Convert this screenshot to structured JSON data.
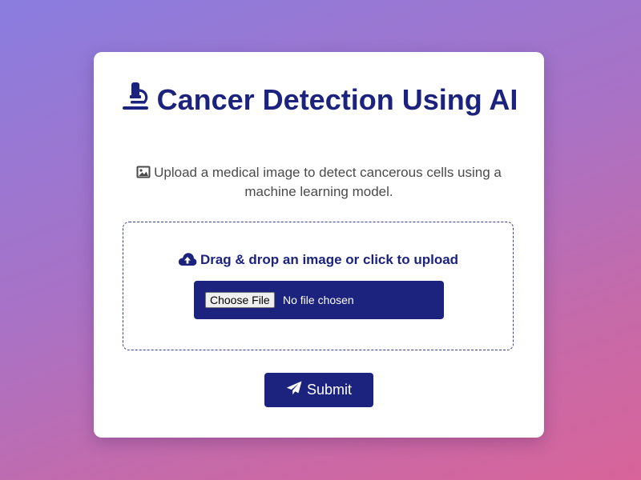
{
  "header": {
    "title": "Cancer Detection Using AI",
    "title_icon": "microscope-icon"
  },
  "description": {
    "text": "Upload a medical image to detect cancerous cells using a machine learning model.",
    "icon": "image-icon"
  },
  "upload": {
    "label": "Drag & drop an image or click to upload",
    "icon": "cloud-upload-icon",
    "choose_label": "Choose File",
    "status": "No file chosen"
  },
  "submit": {
    "label": "Submit",
    "icon": "paper-plane-icon"
  },
  "colors": {
    "primary": "#1c237e",
    "text_muted": "#4a4a4a",
    "background_start": "#8a7ddf",
    "background_end": "#d8649a",
    "card": "#ffffff"
  }
}
